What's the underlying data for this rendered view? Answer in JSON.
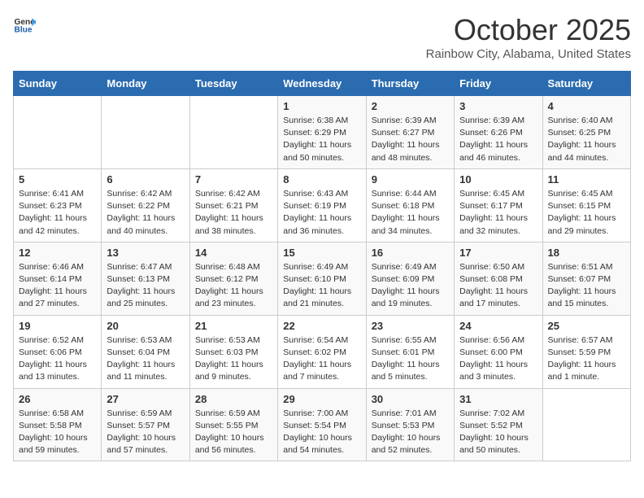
{
  "header": {
    "logo_general": "General",
    "logo_blue": "Blue",
    "month": "October 2025",
    "location": "Rainbow City, Alabama, United States"
  },
  "days_of_week": [
    "Sunday",
    "Monday",
    "Tuesday",
    "Wednesday",
    "Thursday",
    "Friday",
    "Saturday"
  ],
  "weeks": [
    [
      {
        "day": "",
        "data": ""
      },
      {
        "day": "",
        "data": ""
      },
      {
        "day": "",
        "data": ""
      },
      {
        "day": "1",
        "data": "Sunrise: 6:38 AM\nSunset: 6:29 PM\nDaylight: 11 hours and 50 minutes."
      },
      {
        "day": "2",
        "data": "Sunrise: 6:39 AM\nSunset: 6:27 PM\nDaylight: 11 hours and 48 minutes."
      },
      {
        "day": "3",
        "data": "Sunrise: 6:39 AM\nSunset: 6:26 PM\nDaylight: 11 hours and 46 minutes."
      },
      {
        "day": "4",
        "data": "Sunrise: 6:40 AM\nSunset: 6:25 PM\nDaylight: 11 hours and 44 minutes."
      }
    ],
    [
      {
        "day": "5",
        "data": "Sunrise: 6:41 AM\nSunset: 6:23 PM\nDaylight: 11 hours and 42 minutes."
      },
      {
        "day": "6",
        "data": "Sunrise: 6:42 AM\nSunset: 6:22 PM\nDaylight: 11 hours and 40 minutes."
      },
      {
        "day": "7",
        "data": "Sunrise: 6:42 AM\nSunset: 6:21 PM\nDaylight: 11 hours and 38 minutes."
      },
      {
        "day": "8",
        "data": "Sunrise: 6:43 AM\nSunset: 6:19 PM\nDaylight: 11 hours and 36 minutes."
      },
      {
        "day": "9",
        "data": "Sunrise: 6:44 AM\nSunset: 6:18 PM\nDaylight: 11 hours and 34 minutes."
      },
      {
        "day": "10",
        "data": "Sunrise: 6:45 AM\nSunset: 6:17 PM\nDaylight: 11 hours and 32 minutes."
      },
      {
        "day": "11",
        "data": "Sunrise: 6:45 AM\nSunset: 6:15 PM\nDaylight: 11 hours and 29 minutes."
      }
    ],
    [
      {
        "day": "12",
        "data": "Sunrise: 6:46 AM\nSunset: 6:14 PM\nDaylight: 11 hours and 27 minutes."
      },
      {
        "day": "13",
        "data": "Sunrise: 6:47 AM\nSunset: 6:13 PM\nDaylight: 11 hours and 25 minutes."
      },
      {
        "day": "14",
        "data": "Sunrise: 6:48 AM\nSunset: 6:12 PM\nDaylight: 11 hours and 23 minutes."
      },
      {
        "day": "15",
        "data": "Sunrise: 6:49 AM\nSunset: 6:10 PM\nDaylight: 11 hours and 21 minutes."
      },
      {
        "day": "16",
        "data": "Sunrise: 6:49 AM\nSunset: 6:09 PM\nDaylight: 11 hours and 19 minutes."
      },
      {
        "day": "17",
        "data": "Sunrise: 6:50 AM\nSunset: 6:08 PM\nDaylight: 11 hours and 17 minutes."
      },
      {
        "day": "18",
        "data": "Sunrise: 6:51 AM\nSunset: 6:07 PM\nDaylight: 11 hours and 15 minutes."
      }
    ],
    [
      {
        "day": "19",
        "data": "Sunrise: 6:52 AM\nSunset: 6:06 PM\nDaylight: 11 hours and 13 minutes."
      },
      {
        "day": "20",
        "data": "Sunrise: 6:53 AM\nSunset: 6:04 PM\nDaylight: 11 hours and 11 minutes."
      },
      {
        "day": "21",
        "data": "Sunrise: 6:53 AM\nSunset: 6:03 PM\nDaylight: 11 hours and 9 minutes."
      },
      {
        "day": "22",
        "data": "Sunrise: 6:54 AM\nSunset: 6:02 PM\nDaylight: 11 hours and 7 minutes."
      },
      {
        "day": "23",
        "data": "Sunrise: 6:55 AM\nSunset: 6:01 PM\nDaylight: 11 hours and 5 minutes."
      },
      {
        "day": "24",
        "data": "Sunrise: 6:56 AM\nSunset: 6:00 PM\nDaylight: 11 hours and 3 minutes."
      },
      {
        "day": "25",
        "data": "Sunrise: 6:57 AM\nSunset: 5:59 PM\nDaylight: 11 hours and 1 minute."
      }
    ],
    [
      {
        "day": "26",
        "data": "Sunrise: 6:58 AM\nSunset: 5:58 PM\nDaylight: 10 hours and 59 minutes."
      },
      {
        "day": "27",
        "data": "Sunrise: 6:59 AM\nSunset: 5:57 PM\nDaylight: 10 hours and 57 minutes."
      },
      {
        "day": "28",
        "data": "Sunrise: 6:59 AM\nSunset: 5:55 PM\nDaylight: 10 hours and 56 minutes."
      },
      {
        "day": "29",
        "data": "Sunrise: 7:00 AM\nSunset: 5:54 PM\nDaylight: 10 hours and 54 minutes."
      },
      {
        "day": "30",
        "data": "Sunrise: 7:01 AM\nSunset: 5:53 PM\nDaylight: 10 hours and 52 minutes."
      },
      {
        "day": "31",
        "data": "Sunrise: 7:02 AM\nSunset: 5:52 PM\nDaylight: 10 hours and 50 minutes."
      },
      {
        "day": "",
        "data": ""
      }
    ]
  ]
}
